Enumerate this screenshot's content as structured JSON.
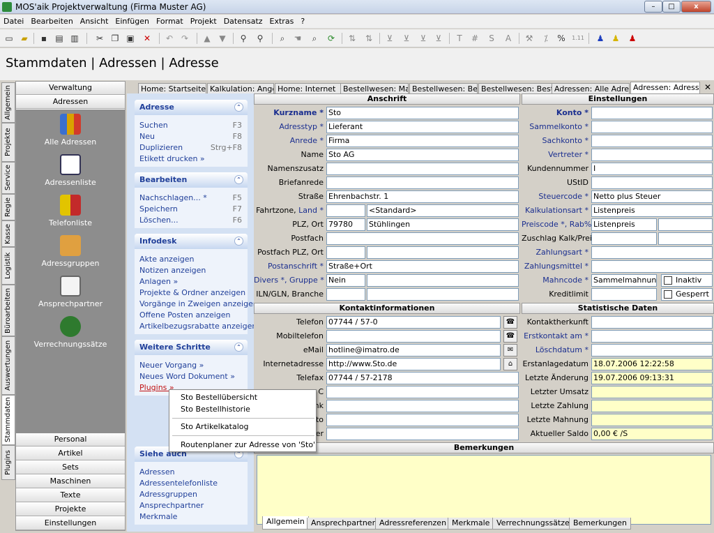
{
  "window": {
    "title": "MOS'aik Projektverwaltung (Firma Muster AG)",
    "minimize": "–",
    "maximize": "□",
    "close": "x"
  },
  "menu": [
    "Datei",
    "Bearbeiten",
    "Ansicht",
    "Einfügen",
    "Format",
    "Projekt",
    "Datensatz",
    "Extras",
    "?"
  ],
  "toolbar_icons": [
    "new-icon",
    "open-icon",
    "save-icon",
    "print-icon",
    "print-preview-icon",
    "cut-icon",
    "copy-icon",
    "paste-icon",
    "delete-icon",
    "undo-icon",
    "redo-icon",
    "move-up-icon",
    "move-down-icon",
    "binoculars-icon",
    "find-next-icon",
    "search-icon",
    "hand-icon",
    "zoom-icon",
    "refresh-icon",
    "sort-asc-icon",
    "sort-desc-icon",
    "filter-icon",
    "filter-2-icon",
    "filter-3-icon",
    "filter-4-icon",
    "text-icon",
    "number-icon",
    "s-icon",
    "a-icon",
    "tools-icon",
    "percent-sign-icon",
    "percent-icon",
    "ratio-icon",
    "user-blue-icon",
    "user-yellow-icon",
    "user-red-icon"
  ],
  "toolbar_glyphs": {
    "text": "T",
    "number": "#",
    "s": "S",
    "a": "A",
    "percent": "%",
    "ratio": "1.11"
  },
  "page_title": "Stammdaten | Adressen | Adresse",
  "vertical_tabs": [
    "Allgemein",
    "Projekte",
    "Service",
    "Regie",
    "Kasse",
    "Logistik",
    "Büroarbeiten",
    "Auswertungen",
    "Stammdaten",
    "Plugins"
  ],
  "left_panel": {
    "top_headers": [
      "Verwaltung",
      "Adressen"
    ],
    "icons": [
      {
        "label": "Alle Adressen",
        "icon": "people-icon"
      },
      {
        "label": "Adressenliste",
        "icon": "address-list-icon"
      },
      {
        "label": "Telefonliste",
        "icon": "phone-book-icon"
      },
      {
        "label": "Adressgruppen",
        "icon": "address-group-icon"
      },
      {
        "label": "Ansprechpartner",
        "icon": "contact-person-icon"
      },
      {
        "label": "Verrechnungssätze",
        "icon": "money-bag-icon"
      }
    ],
    "bottom_headers": [
      "Personal",
      "Artikel",
      "Sets",
      "Maschinen",
      "Texte",
      "Projekte",
      "Einstellungen"
    ]
  },
  "tabs": [
    "Home: Startseite",
    "Kalkulation: Angeb",
    "Home: Internet",
    "Bestellwesen: Mat",
    "Bestellwesen: Bes",
    "Bestellwesen: Beste",
    "Adressen: Alle Adres",
    "Adressen: Adresse"
  ],
  "tab_close": "✕",
  "taskpane": {
    "chevron": "⌃",
    "adresse": {
      "title": "Adresse",
      "items": [
        {
          "label": "Suchen",
          "key": "F3"
        },
        {
          "label": "Neu",
          "key": "F8"
        },
        {
          "label": "Duplizieren",
          "key": "Strg+F8"
        },
        {
          "label": "Etikett drucken »",
          "key": ""
        }
      ]
    },
    "bearbeiten": {
      "title": "Bearbeiten",
      "items": [
        {
          "label": "Nachschlagen...  *",
          "key": "F5"
        },
        {
          "label": "Speichern",
          "key": "F7"
        },
        {
          "label": "Löschen...",
          "key": "F6"
        }
      ]
    },
    "infodesk": {
      "title": "Infodesk",
      "items": [
        "Akte anzeigen",
        "Notizen anzeigen",
        "Anlagen »",
        "Projekte & Ordner anzeigen",
        "Vorgänge in Zweigen anzeigen",
        "Offene Posten anzeigen",
        "Artikelbezugsrabatte anzeigen"
      ]
    },
    "weitere": {
      "title": "Weitere Schritte",
      "items": [
        "Neuer Vorgang »",
        "Neues Word Dokument »",
        "Plugins »"
      ]
    },
    "siehe": {
      "title": "Siehe auch",
      "items": [
        "Adressen",
        "Adressentelefonliste",
        "Adressgruppen",
        "Ansprechpartner",
        "Merkmale"
      ]
    }
  },
  "popup": [
    "Sto Bestellübersicht",
    "Sto Bestellhistorie",
    "Sto Artikelkatalog",
    "Routenplaner zur Adresse von 'Sto'"
  ],
  "sections": {
    "anschrift": "Anschrift",
    "einstellungen": "Einstellungen",
    "kontakt": "Kontaktinformationen",
    "statistik": "Statistische Daten",
    "bemerkungen": "Bemerkungen"
  },
  "anschrift": {
    "kurzname": {
      "label": "Kurzname *",
      "value": "Sto"
    },
    "adresstyp": {
      "label": "Adresstyp *",
      "value": "Lieferant"
    },
    "anrede": {
      "label": "Anrede *",
      "value": "Firma"
    },
    "name": {
      "label": "Name",
      "value": "Sto AG"
    },
    "namenszusatz": {
      "label": "Namenszusatz",
      "value": ""
    },
    "briefanrede": {
      "label": "Briefanrede",
      "value": ""
    },
    "strasse": {
      "label": "Straße",
      "value": "Ehrenbachstr. 1"
    },
    "fahrtzone": {
      "label_a": "Fahrtzone,",
      "label_b": "Land *",
      "value_a": "",
      "value_b": "<Standard>"
    },
    "plzort": {
      "label": "PLZ, Ort",
      "plz": "79780",
      "ort": "Stühlingen"
    },
    "postfach": {
      "label": "Postfach",
      "value": ""
    },
    "postfachplz": {
      "label": "Postfach PLZ, Ort",
      "plz": "",
      "ort": ""
    },
    "postanschrift": {
      "label": "Postanschrift *",
      "value": "Straße+Ort"
    },
    "divers": {
      "label": "Divers *, Gruppe *",
      "value_a": "Nein",
      "value_b": ""
    },
    "iln": {
      "label": "ILN/GLN, Branche",
      "value_a": "",
      "value_b": ""
    }
  },
  "einstellungen": {
    "konto": {
      "label": "Konto *",
      "value": ""
    },
    "sammelkonto": {
      "label": "Sammelkonto *",
      "value": ""
    },
    "sachkonto": {
      "label": "Sachkonto *",
      "value": ""
    },
    "vertreter": {
      "label": "Vertreter *",
      "value": ""
    },
    "kundennummer": {
      "label": "Kundennummer",
      "value": "I"
    },
    "ustid": {
      "label": "UStID",
      "value": ""
    },
    "steuercode": {
      "label": "Steuercode *",
      "value": "Netto plus Steuer"
    },
    "kalkulationsart": {
      "label": "Kalkulationsart *",
      "value": "Listenpreis"
    },
    "preiscode": {
      "label": "Preiscode *, Rab%",
      "value_a": "Listenpreis",
      "value_b": ""
    },
    "zuschlag": {
      "label": "Zuschlag Kalk/Preis",
      "value_a": "",
      "value_b": ""
    },
    "zahlungsart": {
      "label": "Zahlungsart *",
      "value": ""
    },
    "zahlungsmittel": {
      "label": "Zahlungsmittel *",
      "value": ""
    },
    "mahncode": {
      "label": "Mahncode *",
      "value": "Sammelmahnung",
      "check": "Inaktiv"
    },
    "kreditlimit": {
      "label": "Kreditlimit",
      "value": "",
      "check": "Gesperrt"
    }
  },
  "kontakt": {
    "telefon": {
      "label": "Telefon",
      "value": "07744 / 57-0"
    },
    "mobiltelefon": {
      "label": "Mobiltelefon",
      "value": ""
    },
    "email": {
      "label": "eMail",
      "value": "hotline@imatro.de"
    },
    "internet": {
      "label": "Internetadresse",
      "value": "http://www.Sto.de"
    },
    "telefax": {
      "label": "Telefax",
      "value": "07744 / 57-2178"
    },
    "partial_labels": [
      "C",
      "nk",
      "nto",
      "er"
    ]
  },
  "statistik": {
    "kontaktherkunft": {
      "label": "Kontaktherkunft",
      "value": ""
    },
    "erstkontakt": {
      "label": "Erstkontakt am *",
      "value": ""
    },
    "loeschdatum": {
      "label": "Löschdatum *",
      "value": ""
    },
    "erstanlage": {
      "label": "Erstanlagedatum",
      "value": "18.07.2006 12:22:58"
    },
    "aenderung": {
      "label": "Letzte Änderung",
      "value": "19.07.2006 09:13:31"
    },
    "umsatz": {
      "label": "Letzter Umsatz",
      "value": ""
    },
    "zahlung": {
      "label": "Letzte Zahlung",
      "value": ""
    },
    "mahnung": {
      "label": "Letzte Mahnung",
      "value": ""
    },
    "saldo": {
      "label": "Aktueller Saldo",
      "value": "0,00 € /S"
    }
  },
  "bottom_tabs": [
    "Allgemein",
    "Ansprechpartner",
    "Adressreferenzen",
    "Merkmale",
    "Verrechnungssätze",
    "Bemerkungen"
  ]
}
